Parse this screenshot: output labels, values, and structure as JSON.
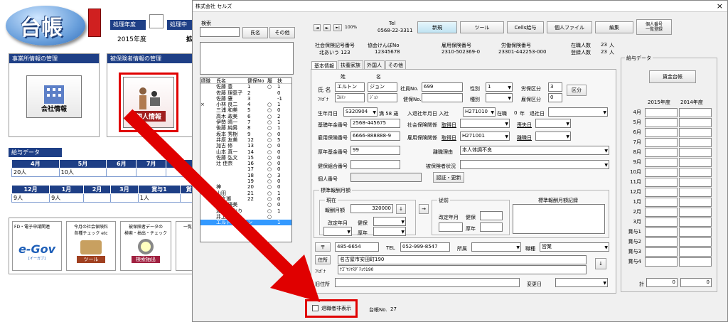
{
  "app": {
    "logo_text": "台帳",
    "processing_year_label": "処理年度",
    "processing_year_label2": "処理中",
    "year_value": "2015年度",
    "cut_char": "拡",
    "office_section_title": "事業所情報の管理",
    "insured_section_title": "被保険者情報の管理",
    "company_info_label": "会社情報",
    "personal_info_label": "個人情報",
    "salary_section_title": "給与データ",
    "salary_headers_1": [
      "4月",
      "5月",
      "6月",
      "7月",
      "8月"
    ],
    "salary_row_1": [
      "20人",
      "10人",
      "",
      "",
      ""
    ],
    "salary_headers_2": [
      "12月",
      "1月",
      "2月",
      "3月",
      "賞与1"
    ],
    "salary_headers_2_extra": "賞",
    "salary_row_2": [
      "9人",
      "9人",
      "",
      "",
      "1人"
    ],
    "tools": [
      {
        "title": "FD・電子申請関連",
        "label": "e-Gov"
      },
      {
        "title": "今月の社会保険料\n各種チェック etc",
        "label": "ツール"
      },
      {
        "title": "被保険者データの\n検索・抽出・チェック",
        "label": "検索抽出"
      },
      {
        "title": "一覧",
        "label": ""
      }
    ],
    "egov_sub": "[イーガブ]"
  },
  "dialog": {
    "title": "株式会社 セルズ",
    "close_icon": "×",
    "search_label": "検索",
    "search_value": "",
    "name_button": "氏名",
    "other_button": "その他",
    "nav_prev": "◄",
    "nav_next": "►",
    "nav_end": "►|",
    "zoom": "100%",
    "tel_label": "Tel",
    "tel_value": "0568-22-3311",
    "new_button": "新規",
    "tool_button": "ツール",
    "cells_button": "Cells給与",
    "personal_file_button": "個人ファイル",
    "edit_button": "編集",
    "mynumber_button": "個人番号\n一覧登録",
    "office_symbol_label": "社会保険記号番号",
    "office_symbol_value": "北あいう 123",
    "kyokai_label": "協会けんぽNo",
    "kyokai_value": "12345678",
    "employment_ins_label": "雇用保険番号",
    "employment_ins_value": "2310-502369-0",
    "labor_ins_label": "労働保険番号",
    "labor_ins_value": "23301-442253-000",
    "enrolled_label": "在職人数",
    "enrolled_value": "23",
    "registered_label": "登録人数",
    "registered_value": "23",
    "person_unit": "人",
    "list_headers": [
      "退職",
      "氏名",
      "健保No",
      "履",
      "扶"
    ],
    "list_rows": [
      {
        "ret": "",
        "name": "佐藤 豊",
        "no": "1",
        "ri": "○",
        "fu": "1"
      },
      {
        "ret": "",
        "name": "佐藤 理恵子",
        "no": "2",
        "ri": "",
        "fu": "0"
      },
      {
        "ret": "",
        "name": "佐藤 肇",
        "no": "3",
        "ri": "",
        "fu": "-1"
      },
      {
        "ret": "×",
        "name": "小林 良二",
        "no": "4",
        "ri": "○",
        "fu": "1"
      },
      {
        "ret": "",
        "name": "三浦 和美",
        "no": "5",
        "ri": "○",
        "fu": "0"
      },
      {
        "ret": "",
        "name": "高木 政美",
        "no": "6",
        "ri": "○",
        "fu": "2"
      },
      {
        "ret": "",
        "name": "伊勢 晴一",
        "no": "7",
        "ri": "○",
        "fu": "1"
      },
      {
        "ret": "",
        "name": "後藤 純男",
        "no": "8",
        "ri": "○",
        "fu": "1"
      },
      {
        "ret": "",
        "name": "坂本 秀樹",
        "no": "9",
        "ri": "○",
        "fu": "0"
      },
      {
        "ret": "",
        "name": "井原 友美",
        "no": "12",
        "ri": "○",
        "fu": "5"
      },
      {
        "ret": "",
        "name": "加古 修",
        "no": "13",
        "ri": "○",
        "fu": "0"
      },
      {
        "ret": "",
        "name": "山本 真一",
        "no": "14",
        "ri": "○",
        "fu": "0"
      },
      {
        "ret": "",
        "name": "佐藤 弘文",
        "no": "15",
        "ri": "○",
        "fu": "0"
      },
      {
        "ret": "",
        "name": "辻 佳奈",
        "no": "16",
        "ri": "○",
        "fu": "0"
      },
      {
        "ret": "",
        "name": "",
        "no": "17",
        "ri": "○",
        "fu": "0"
      },
      {
        "ret": "",
        "name": "",
        "no": "18",
        "ri": "○",
        "fu": "3"
      },
      {
        "ret": "",
        "name": "",
        "no": "19",
        "ri": "○",
        "fu": "0"
      },
      {
        "ret": "",
        "name": "神",
        "no": "20",
        "ri": "○",
        "fu": "0"
      },
      {
        "ret": "",
        "name": "山田",
        "no": "21",
        "ri": "○",
        "fu": "1"
      },
      {
        "ret": "",
        "name": "一之瀬",
        "no": "22",
        "ri": "○",
        "fu": "0"
      },
      {
        "ret": "",
        "name": "田口 優美",
        "no": "",
        "ri": "○",
        "fu": "0"
      },
      {
        "ret": "",
        "name": "渡邉 かおり",
        "no": "",
        "ri": "○",
        "fu": "1"
      },
      {
        "ret": "",
        "name": "井上 五郎",
        "no": "",
        "ri": "○",
        "fu": ""
      },
      {
        "ret": "",
        "name": "エルトン ジョン",
        "no": "",
        "ri": "",
        "fu": "1"
      }
    ],
    "tabs": [
      "基本情報",
      "扶養家族",
      "外国人",
      "その他"
    ],
    "name_label": "氏 名",
    "sei_label": "姓",
    "mei_label": "名",
    "sei_value": "エルトン",
    "mei_value": "ジョン",
    "furigana_label": "ﾌﾘｶﾞﾅ",
    "furi_sei": "ｴﾙﾄﾝ",
    "furi_mei": "ｼﾞｮﾝ",
    "employee_no_label": "社員No.",
    "employee_no_value": "699",
    "kenpo_no_label": "健保No.",
    "gender_label": "性別",
    "gender_value": "1",
    "kind_label": "種別",
    "kind_value": "",
    "labor_class_label": "労保区分",
    "labor_class_value": "3",
    "emp_class_label": "雇保区分",
    "emp_class_value": "0",
    "class_button": "区分",
    "birth_label": "生年月日",
    "birth_value": "S320904",
    "age_label": "満 58 歳",
    "join_label": "入退社年月日 入社",
    "join_value": "H271010",
    "tenure_label": "在職",
    "tenure_value": "0",
    "tenure_unit": "年",
    "leave_label": "退社日",
    "pension_label": "基礎年金番号",
    "pension_value": "2568-445675",
    "social_ins_label": "社会保険関係",
    "acquire_label": "取得日",
    "loss_label": "喪失日",
    "emp_ins_no_label": "雇用保険番号",
    "emp_ins_no_value": "6666-888888-9",
    "emp_ins_rel_label": "雇用保険関係",
    "acquire_label2": "取得日",
    "acquire_value2": "H271001",
    "leave_day_label": "離職日",
    "welfare_label": "厚年基金番号",
    "welfare_value": "99",
    "reason_label": "離職理由",
    "reason_value": "本人体調不良",
    "health_union_label": "健保組合番号",
    "insured_status_label": "被保険者状況",
    "mynumber_label": "個人番号",
    "auth_button": "認証・更新",
    "std_group_label": "標準報酬月額",
    "current_label": "現在",
    "monthly_label": "報酬月額",
    "monthly_value": "320000",
    "down_icon": "↓",
    "arrow_icon": "→",
    "prev_label": "従前",
    "revised_label": "改定年月",
    "kenpo_label": "健保",
    "kounen_label": "厚年",
    "record_label": "標準報酬月額記録",
    "postal_icon": "〒",
    "postal_value": "485-6654",
    "tel2_label": "TEL",
    "tel2_value": "052-999-8547",
    "dept_label": "所属",
    "job_label": "職種",
    "job_value": "営業",
    "address_label": "住所",
    "address_value": "名古屋市安田町190",
    "furi_addr_label": "ﾌﾘｶﾞﾅ",
    "furi_addr_value": "ﾅｺﾞﾔｼﾔｽﾀﾞﾁｮｳ190",
    "old_addr_label": "旧住所",
    "change_date_label": "変更日",
    "hide_retired_label": "退職者非表示",
    "ledger_no_label": "台帳No.",
    "ledger_no_value": "27",
    "salary_data_label": "給与データ",
    "wage_ledger_button": "賃金台帳",
    "year1": "2015年度",
    "year2": "2014年度",
    "months": [
      "4月",
      "5月",
      "6月",
      "7月",
      "8月",
      "9月",
      "10月",
      "11月",
      "12月",
      "1月",
      "2月",
      "3月",
      "賞与1",
      "賞与2",
      "賞与3",
      "賞与4"
    ],
    "total_label": "計",
    "total1": "0",
    "total2": "0"
  },
  "colors": {
    "highlight": "#ff0000",
    "selection": "#3399ff",
    "header_blue": "#1e3f86"
  }
}
